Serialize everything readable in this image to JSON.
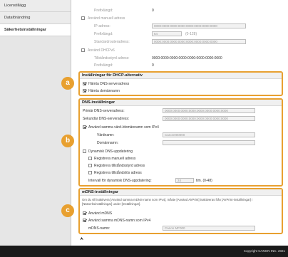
{
  "sidebar": {
    "items": [
      {
        "label": "Licenstillägg"
      },
      {
        "label": "Dataförändring"
      },
      {
        "label": "Säkerhetsinställningar"
      }
    ]
  },
  "ipv6_top": {
    "prefix_length_label": "Prefixlängd:",
    "prefix_length_value": "0",
    "use_manual_label": "Använd manuell adress",
    "ip_label": "IP-adress:",
    "ip_value": "0000:0000:0000:0000:0000:0000:0000:0000",
    "prefix_label": "Prefixlängd:",
    "prefix_value": "64",
    "prefix_range": "(0-128)",
    "default_router_label": "Standardrouteradress:",
    "default_router_value": "0000:0000:0000:0000:0000:0000:0000:0000",
    "use_dhcpv6_label": "Använd DHCPv6",
    "stateful_label": "Tillståndsstyrd adress:",
    "stateful_value": "0000:0000:0000:0000:0000:0000:0000:0000",
    "prefix2_label": "Prefixlängd:",
    "prefix2_value": "0"
  },
  "badges": {
    "a": "a",
    "b": "b",
    "c": "c"
  },
  "section_a": {
    "title": "Inställningar för DHCP-alternativ",
    "get_dns_label": "Hämta DNS-serveradress",
    "get_domain_label": "Hämta domännamn"
  },
  "section_b": {
    "title": "DNS-inställningar",
    "primary_label": "Primär DNS-serveradress:",
    "primary_value": "0000:0000:0000:0000:0000:0000:0000:0000",
    "secondary_label": "Sekundär DNS-serveradress:",
    "secondary_value": "0000:0000:0000:0000:0000:0000:0000:0000",
    "same_host_label": "Använd samma värd-/domännamn som IPv4",
    "hostname_label": "Värdnamn:",
    "hostname_value": "Canon000000",
    "domain_label": "Domännamn:",
    "domain_value": "",
    "dynamic_label": "Dynamisk DNS-uppdatering",
    "reg_manual_label": "Registrera manuell adress",
    "reg_stateful_label": "Registrera tillståndsstyrd adress",
    "reg_stateless_label": "Registrera tillståndslös adress",
    "interval_label": "Intervall för dynamisk DNS-uppdatering:",
    "interval_value": "24",
    "interval_unit": "tim. (0-48)"
  },
  "section_c": {
    "title": "mDNS-inställningar",
    "description": "Om du vill inaktivera [Använd samma mDNS-namn som IPv4], måste [Använd AirPrint] inaktiveras från [AirPrint-inställningar] i [Nätverksinställningar] under [Inställningar].",
    "use_mdns_label": "Använd mDNS",
    "same_mdns_label": "Använd samma mDNS-namn som IPv4",
    "mdns_name_label": "mDNS-namn:",
    "mdns_name_value": "Canon MF000"
  },
  "scroll_indicator": "⮝",
  "footer": {
    "copyright": "Copyright CANON INC. 2021"
  },
  "colors": {
    "accent": "#e8a030",
    "footer": "#1a1a1a",
    "sidebar": "#e6e6e6"
  }
}
